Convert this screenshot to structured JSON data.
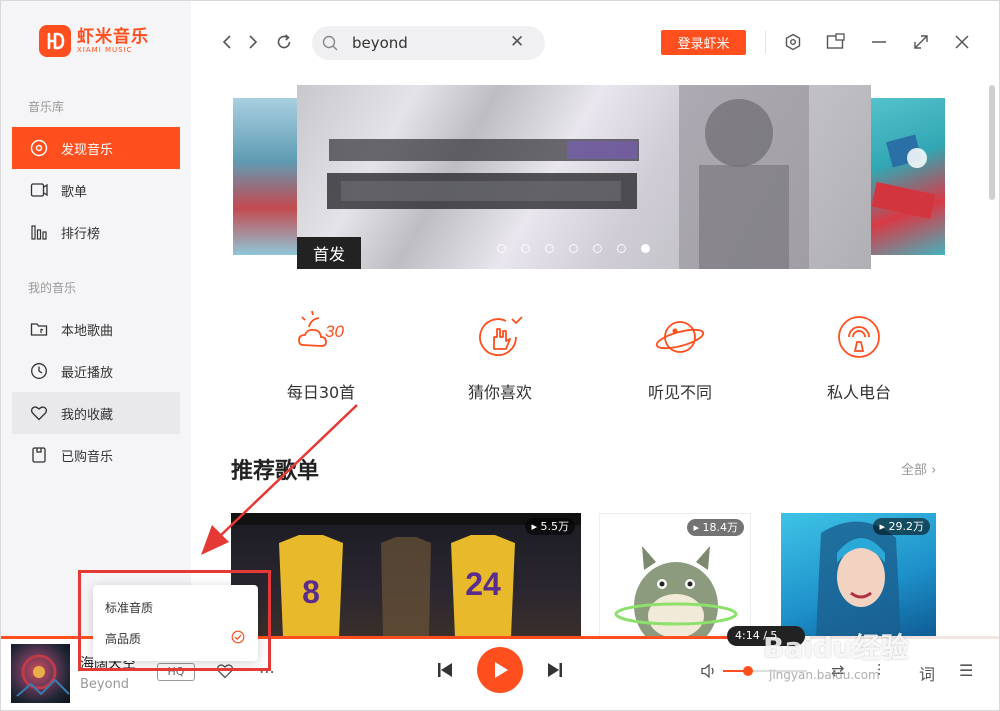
{
  "app": {
    "logo_cn": "虾米音乐",
    "logo_en": "XIAMI MUSIC",
    "accent_color": "#ff4f1e"
  },
  "sidebar": {
    "section_library": "音乐库",
    "library_items": [
      {
        "label": "发现音乐",
        "icon": "disc-icon",
        "active": true
      },
      {
        "label": "歌单",
        "icon": "playlist-icon"
      },
      {
        "label": "排行榜",
        "icon": "chart-icon"
      }
    ],
    "section_mine": "我的音乐",
    "mine_items": [
      {
        "label": "本地歌曲",
        "icon": "folder-icon"
      },
      {
        "label": "最近播放",
        "icon": "clock-icon"
      },
      {
        "label": "我的收藏",
        "icon": "heart-icon",
        "hover": true
      },
      {
        "label": "已购音乐",
        "icon": "bag-icon"
      }
    ]
  },
  "topbar": {
    "search_value": "beyond",
    "login_label": "登录虾米",
    "icons": [
      "back-icon",
      "forward-icon",
      "refresh-icon",
      "search-icon",
      "clear-icon",
      "settings-icon",
      "mini-mode-icon",
      "minimize-icon",
      "maximize-icon",
      "close-icon"
    ]
  },
  "banner": {
    "badge": "首发",
    "dot_count": 7,
    "active_dot": 6
  },
  "quick_links": [
    {
      "label": "每日30首",
      "icon": "daily-30-icon"
    },
    {
      "label": "猜你喜欢",
      "icon": "guess-like-icon"
    },
    {
      "label": "听见不同",
      "icon": "planet-icon"
    },
    {
      "label": "私人电台",
      "icon": "radio-icon"
    }
  ],
  "recommend": {
    "title": "推荐歌单",
    "all_label": "全部",
    "playlists": [
      {
        "count": "5.5万"
      },
      {
        "count": "18.4万"
      },
      {
        "count": "29.2万"
      }
    ]
  },
  "player": {
    "song_title": "海阔天空",
    "artist": "Beyond",
    "quality_badge": "HQ",
    "time_tip": "4:14 / 5",
    "progress": 0.8,
    "volume": 0.3
  },
  "quality_menu": {
    "options": [
      "标准音质",
      "高品质"
    ],
    "selected": 1
  },
  "watermark": {
    "brand": "Baidu经验",
    "url": "jingyan.baidu.com"
  }
}
